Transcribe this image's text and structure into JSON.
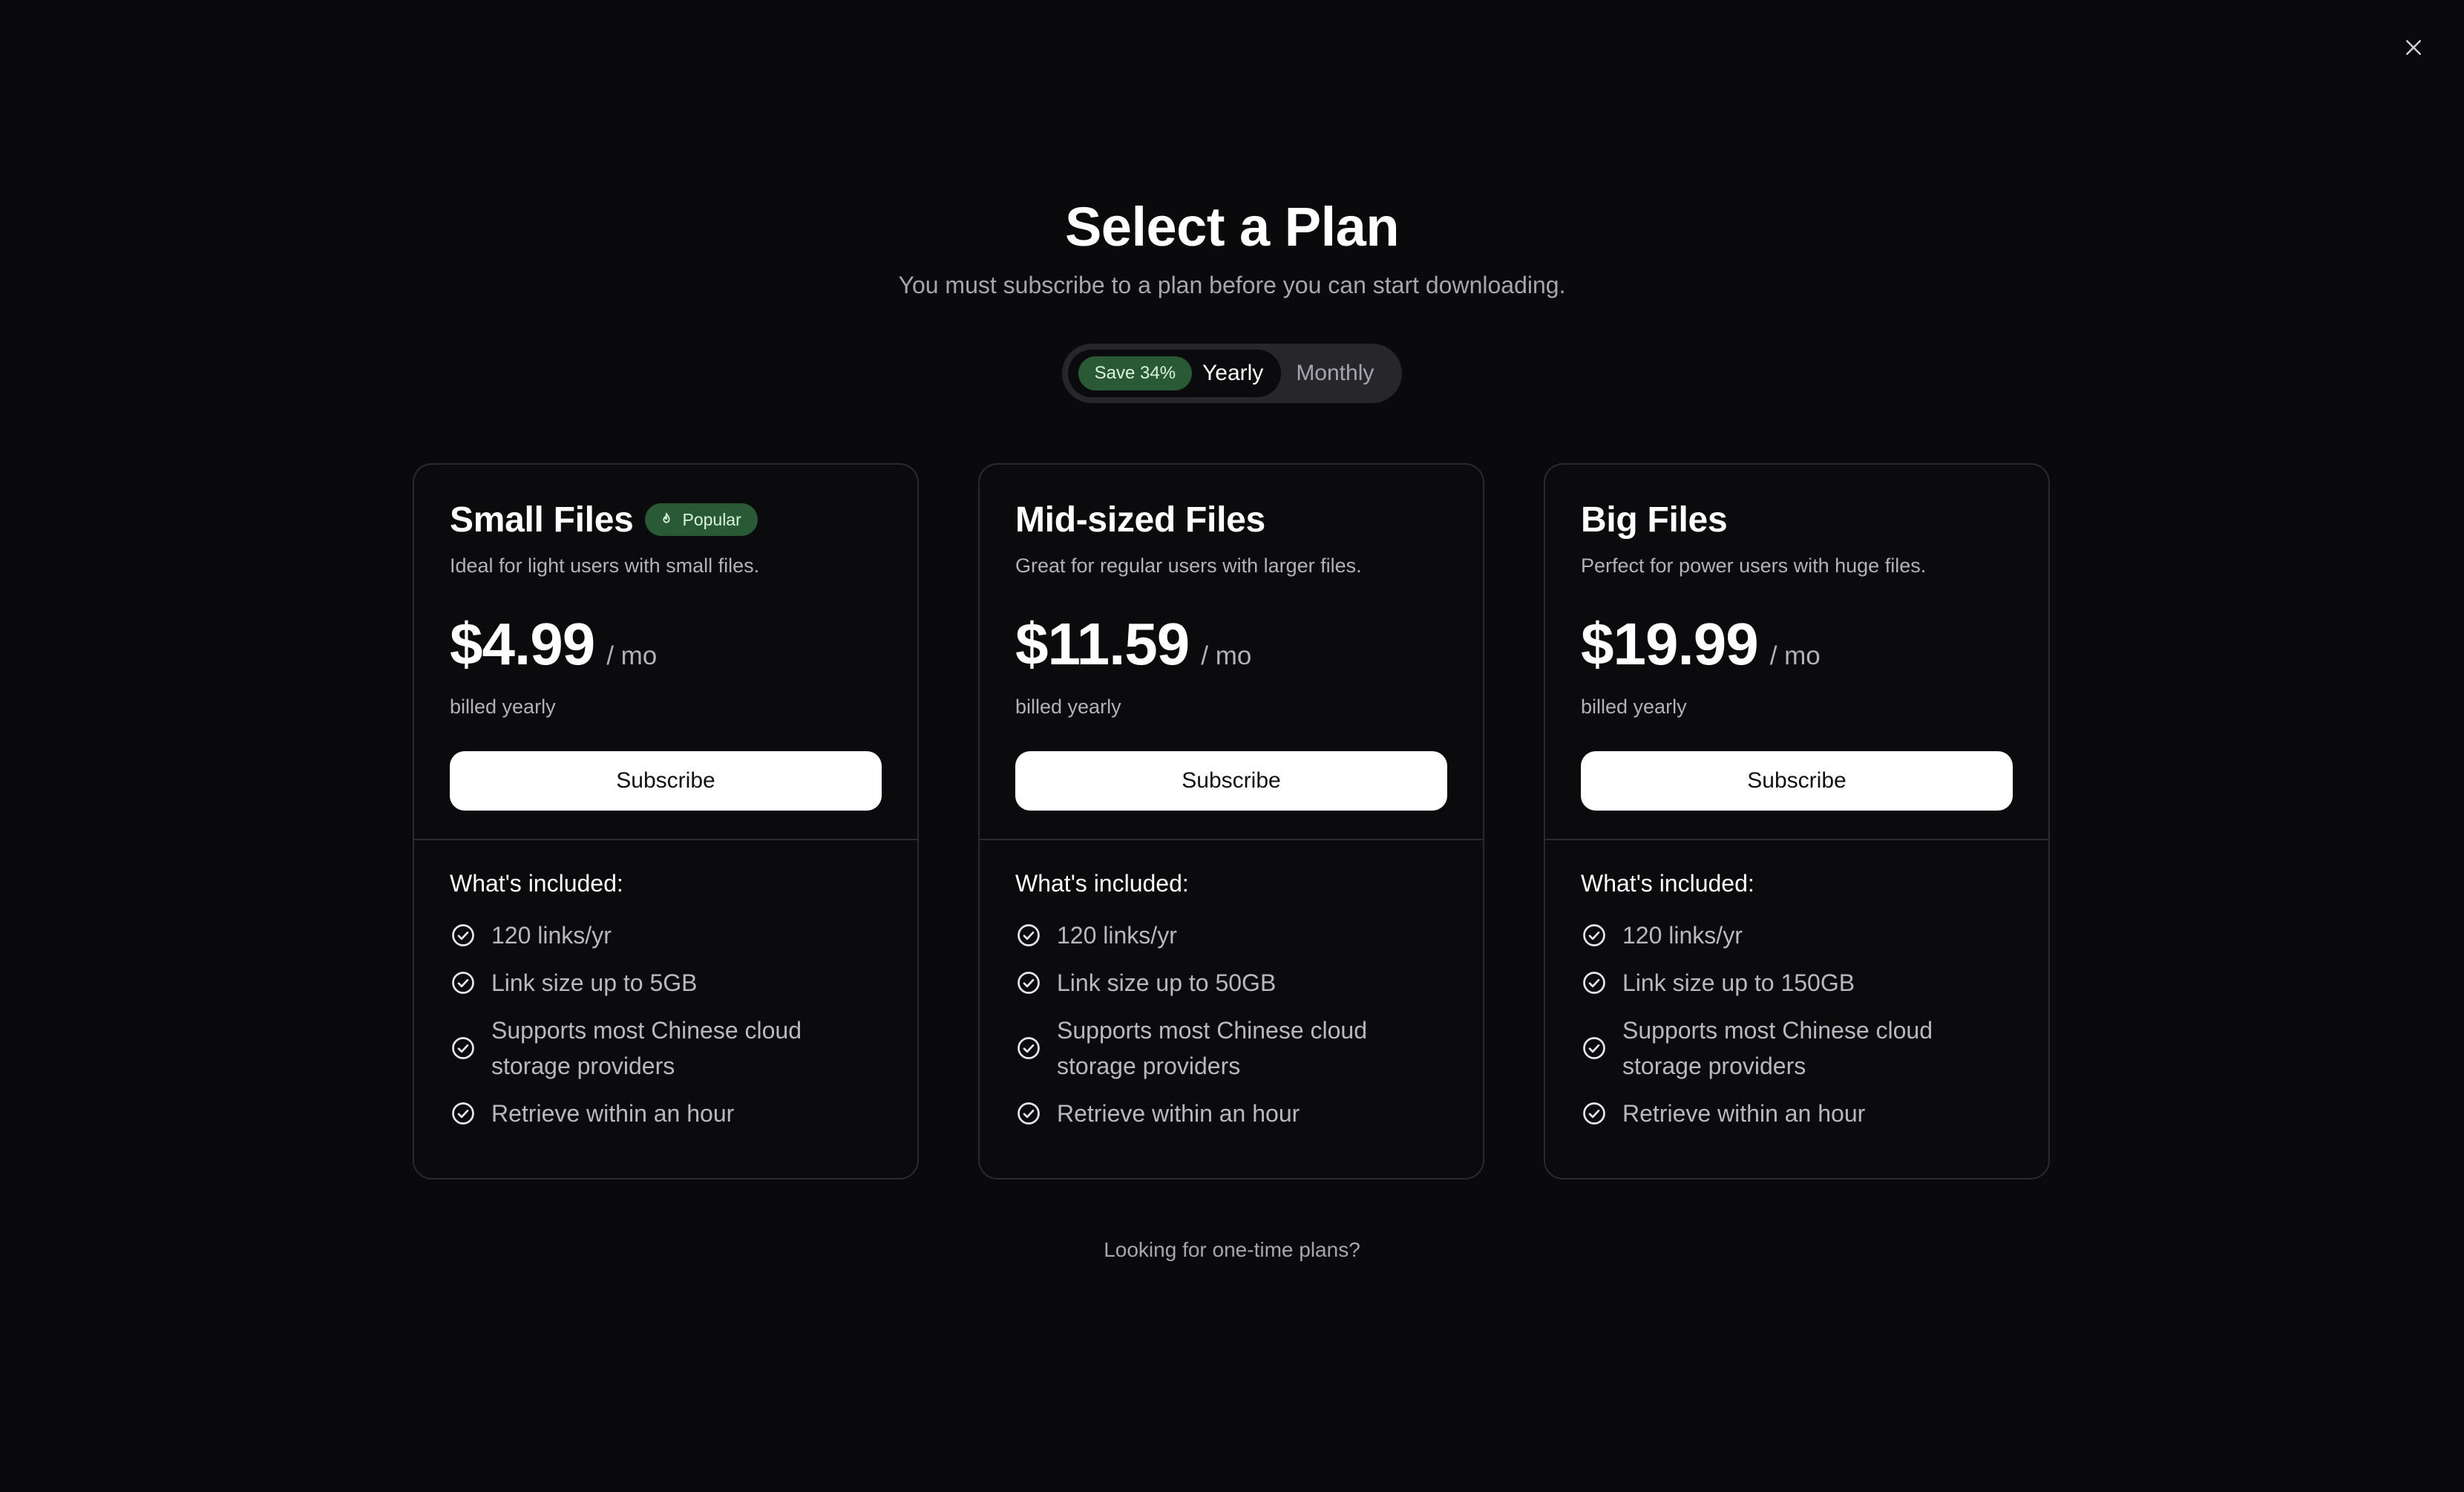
{
  "header": {
    "title": "Select a Plan",
    "subtitle": "You must subscribe to a plan before you can start downloading."
  },
  "billing_toggle": {
    "save_badge": "Save 34%",
    "yearly_label": "Yearly",
    "monthly_label": "Monthly",
    "selected": "Yearly"
  },
  "plans": [
    {
      "name": "Small Files",
      "badge": "Popular",
      "description": "Ideal for light users with small files.",
      "price": "$4.99",
      "period": "/ mo",
      "billing_note": "billed yearly",
      "cta": "Subscribe",
      "included_title": "What's included:",
      "features": [
        "120 links/yr",
        "Link size up to 5GB",
        "Supports most Chinese cloud storage providers",
        "Retrieve within an hour"
      ]
    },
    {
      "name": "Mid-sized Files",
      "description": "Great for regular users with larger files.",
      "price": "$11.59",
      "period": "/ mo",
      "billing_note": "billed yearly",
      "cta": "Subscribe",
      "included_title": "What's included:",
      "features": [
        "120 links/yr",
        "Link size up to 50GB",
        "Supports most Chinese cloud storage providers",
        "Retrieve within an hour"
      ]
    },
    {
      "name": "Big Files",
      "description": "Perfect for power users with huge files.",
      "price": "$19.99",
      "period": "/ mo",
      "billing_note": "billed yearly",
      "cta": "Subscribe",
      "included_title": "What's included:",
      "features": [
        "120 links/yr",
        "Link size up to 150GB",
        "Supports most Chinese cloud storage providers",
        "Retrieve within an hour"
      ]
    }
  ],
  "footer": {
    "one_time_link": "Looking for one-time plans?"
  },
  "icons": {
    "close": "close-icon",
    "popular": "flame-icon",
    "feature": "check-circle-icon"
  },
  "colors": {
    "background": "#0a0a0c",
    "badge_green": "#2a5a35",
    "badge_text": "#d8f3dd",
    "button_bg": "#ffffff",
    "muted_text": "#a6a6ad"
  }
}
